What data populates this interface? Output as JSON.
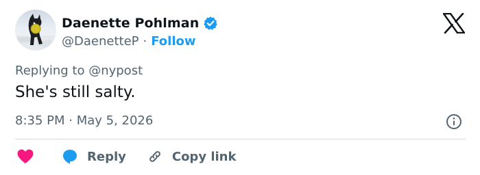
{
  "author": {
    "display_name": "Daenette Pohlman",
    "handle": "@DaenetteP",
    "separator": "·",
    "follow_label": "Follow",
    "verified_color": "#1d9bf0"
  },
  "tweet": {
    "replying_to": "Replying to @nypost",
    "text": "She's still salty.",
    "timestamp": "8:35 PM · May 5, 2026"
  },
  "actions": {
    "reply_label": "Reply",
    "copy_link_label": "Copy link",
    "like_color": "#f91880",
    "reply_color": "#1d9bf0"
  },
  "icons": [
    "avatar",
    "verified-badge-icon",
    "x-logo-icon",
    "info-icon",
    "heart-icon",
    "reply-bubble-icon",
    "link-icon"
  ]
}
